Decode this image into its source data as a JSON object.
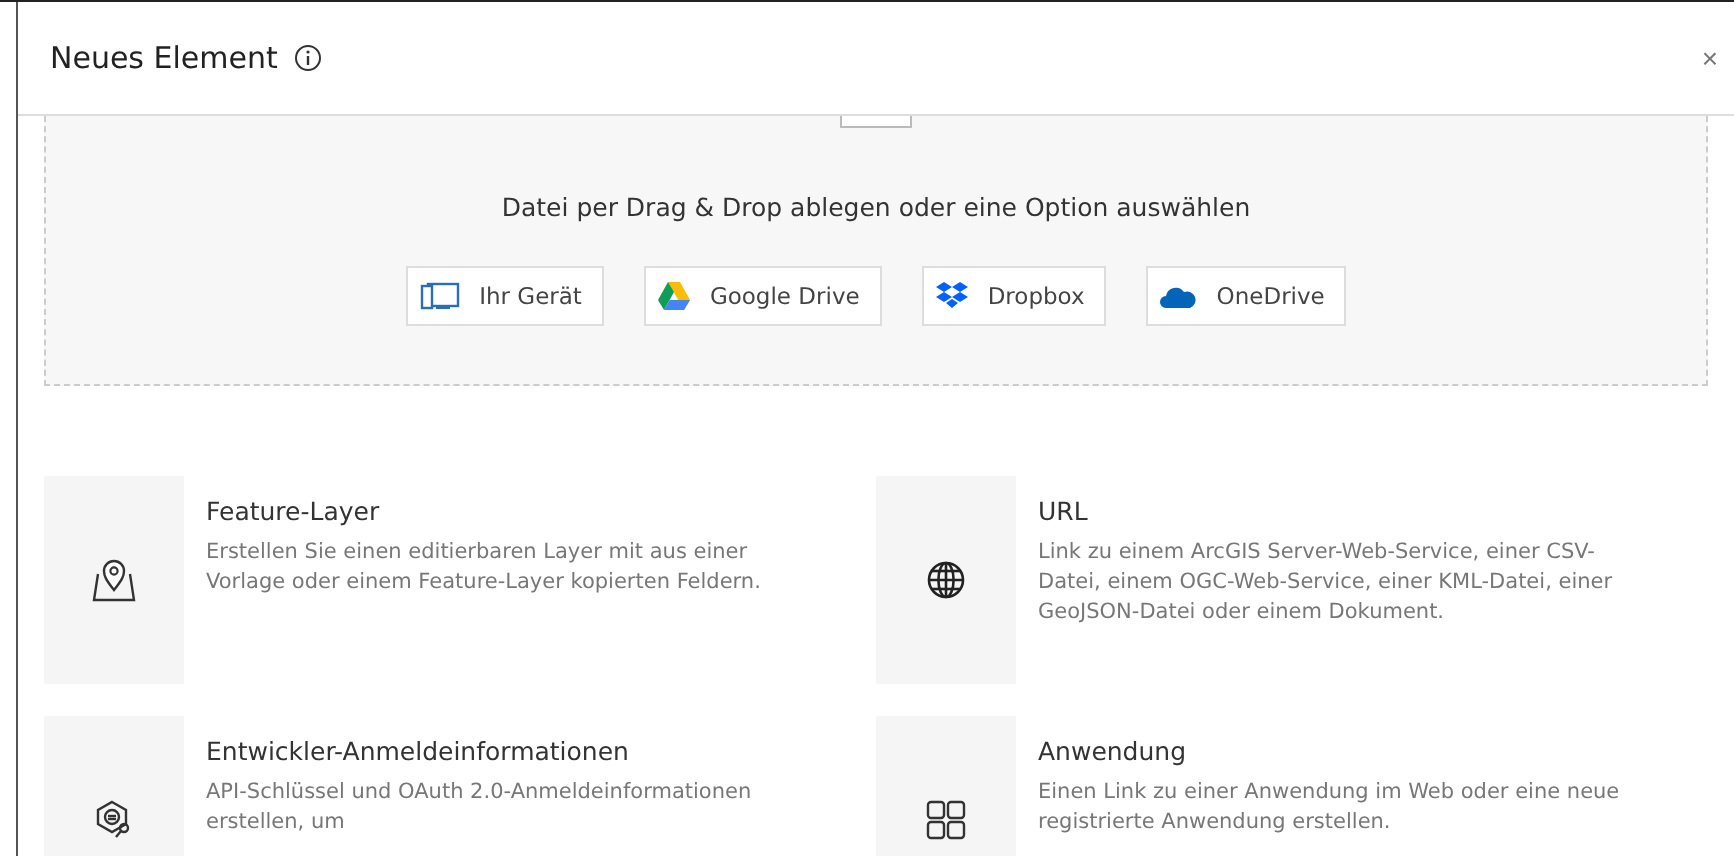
{
  "dialog": {
    "title": "Neues Element",
    "close": "×"
  },
  "dropzone": {
    "prompt": "Datei per Drag & Drop ablegen oder eine Option auswählen",
    "sources": [
      {
        "kind": "device",
        "label": "Ihr Gerät"
      },
      {
        "kind": "gdrive",
        "label": "Google Drive"
      },
      {
        "kind": "dropbox",
        "label": "Dropbox"
      },
      {
        "kind": "onedrive",
        "label": "OneDrive"
      }
    ]
  },
  "options": [
    {
      "kind": "map",
      "title": "Feature-Layer",
      "description": "Erstellen Sie einen editierbaren Layer mit aus einer Vorlage oder einem Feature-Layer kopierten Feldern."
    },
    {
      "kind": "globe",
      "title": "URL",
      "description": "Link zu einem ArcGIS Server-Web-Service, einer CSV-Datei, einem OGC-Web-Service, einer KML-Datei, einer GeoJSON-Datei oder einem Dokument."
    },
    {
      "kind": "key",
      "title": "Entwickler-Anmeldeinformationen",
      "description": "API-Schlüssel und OAuth 2.0-Anmeldeinformationen erstellen, um"
    },
    {
      "kind": "apps",
      "title": "Anwendung",
      "description": "Einen Link zu einer Anwendung im Web oder eine neue registrierte Anwendung erstellen."
    }
  ]
}
